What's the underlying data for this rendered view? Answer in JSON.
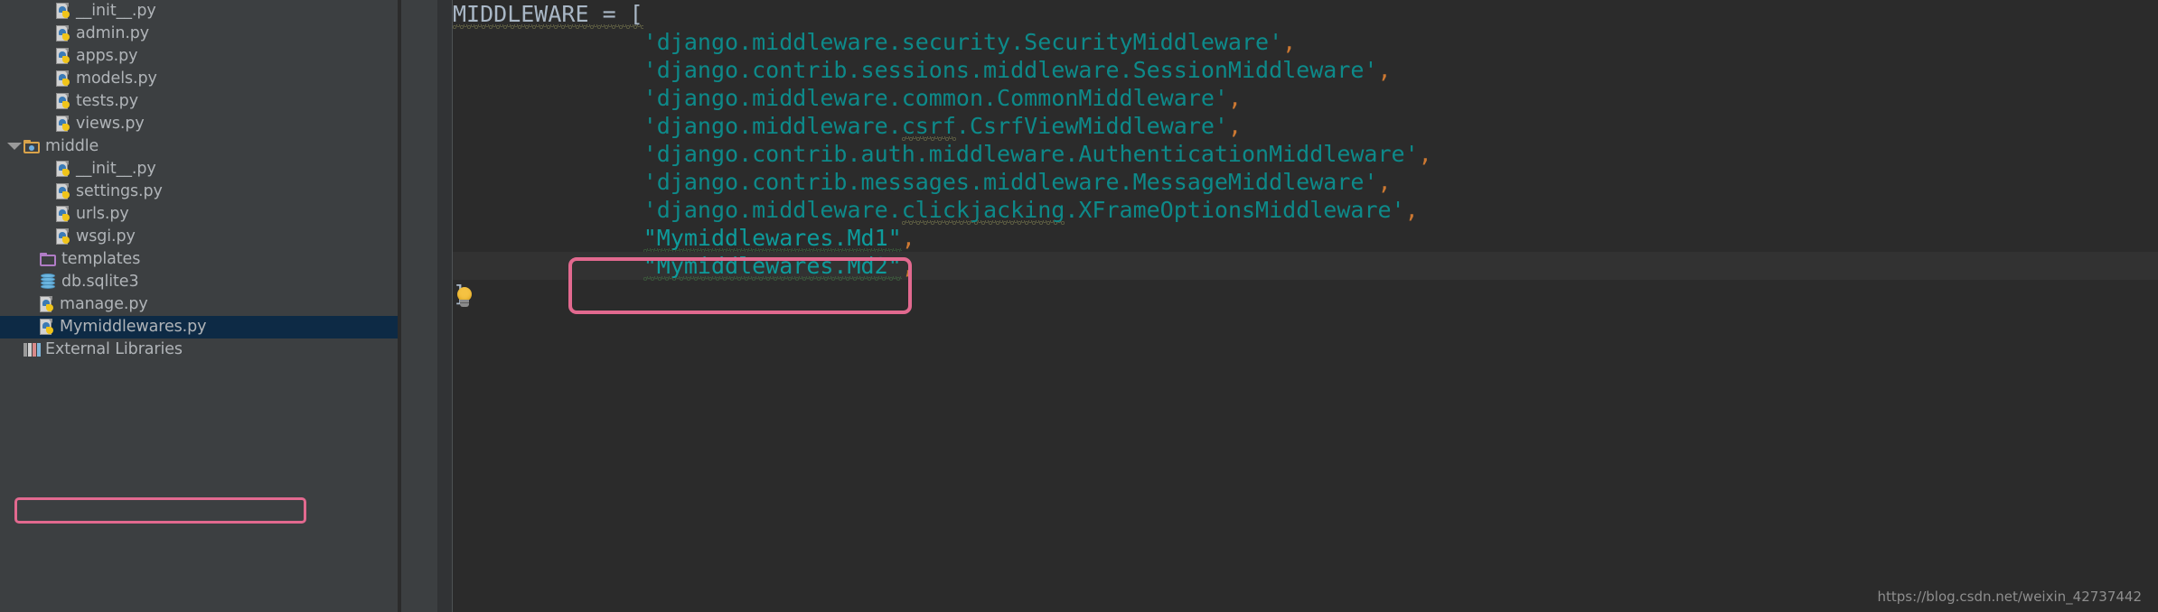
{
  "sidebar": {
    "items": [
      {
        "label": "__init__.py",
        "icon": "python-file-icon",
        "indent": 3,
        "type": "py",
        "arrow": false,
        "selected": false
      },
      {
        "label": "admin.py",
        "icon": "python-file-icon",
        "indent": 3,
        "type": "py",
        "arrow": false,
        "selected": false
      },
      {
        "label": "apps.py",
        "icon": "python-file-icon",
        "indent": 3,
        "type": "py",
        "arrow": false,
        "selected": false
      },
      {
        "label": "models.py",
        "icon": "python-file-icon",
        "indent": 3,
        "type": "py",
        "arrow": false,
        "selected": false
      },
      {
        "label": "tests.py",
        "icon": "python-file-icon",
        "indent": 3,
        "type": "py",
        "arrow": false,
        "selected": false
      },
      {
        "label": "views.py",
        "icon": "python-file-icon",
        "indent": 3,
        "type": "py",
        "arrow": false,
        "selected": false
      },
      {
        "label": "middle",
        "icon": "folder-orange-icon",
        "indent": 1,
        "type": "folder-orange",
        "arrow": true,
        "selected": false
      },
      {
        "label": "__init__.py",
        "icon": "python-file-icon",
        "indent": 3,
        "type": "py",
        "arrow": false,
        "selected": false
      },
      {
        "label": "settings.py",
        "icon": "python-file-icon",
        "indent": 3,
        "type": "py",
        "arrow": false,
        "selected": false
      },
      {
        "label": "urls.py",
        "icon": "python-file-icon",
        "indent": 3,
        "type": "py",
        "arrow": false,
        "selected": false
      },
      {
        "label": "wsgi.py",
        "icon": "python-file-icon",
        "indent": 3,
        "type": "py",
        "arrow": false,
        "selected": false
      },
      {
        "label": "templates",
        "icon": "folder-purple-icon",
        "indent": 2,
        "type": "folder-purple",
        "arrow": false,
        "selected": false
      },
      {
        "label": "db.sqlite3",
        "icon": "database-icon",
        "indent": 2,
        "type": "db",
        "arrow": false,
        "selected": false
      },
      {
        "label": "manage.py",
        "icon": "python-file-icon",
        "indent": 2,
        "type": "py",
        "arrow": false,
        "selected": false
      },
      {
        "label": "Mymiddlewares.py",
        "icon": "python-file-icon",
        "indent": 2,
        "type": "py",
        "arrow": false,
        "selected": true
      },
      {
        "label": "External Libraries",
        "icon": "libraries-icon",
        "indent": 1,
        "type": "lib",
        "arrow": false,
        "selected": false
      }
    ],
    "annotation_color": "#e2698f",
    "selection_color": "#0d2a45"
  },
  "editor": {
    "gutter_hint_icon": "lightbulb-icon",
    "annotation_color": "#e2698f",
    "lines": [
      {
        "indent": 0,
        "parts": [
          {
            "text": "MIDDLEWARE = [",
            "style": "kw",
            "squiggle": "yellow"
          }
        ]
      },
      {
        "indent": 7,
        "parts": [
          {
            "text": "'django.middleware.security.SecurityMiddleware'",
            "style": "str",
            "squiggle": "none"
          },
          {
            "text": ",",
            "style": "punct",
            "squiggle": "none"
          }
        ]
      },
      {
        "indent": 7,
        "parts": [
          {
            "text": "'django.contrib.sessions.middleware.SessionMiddleware'",
            "style": "str",
            "squiggle": "none"
          },
          {
            "text": ",",
            "style": "punct",
            "squiggle": "none"
          }
        ]
      },
      {
        "indent": 7,
        "parts": [
          {
            "text": "'django.middleware.common.CommonMiddleware'",
            "style": "str",
            "squiggle": "none"
          },
          {
            "text": ",",
            "style": "punct",
            "squiggle": "none"
          }
        ]
      },
      {
        "indent": 7,
        "parts": [
          {
            "text": "'django.middleware.",
            "style": "str",
            "squiggle": "none"
          },
          {
            "text": "csrf",
            "style": "str",
            "squiggle": "yellow"
          },
          {
            "text": ".CsrfViewMiddleware'",
            "style": "str",
            "squiggle": "none"
          },
          {
            "text": ",",
            "style": "punct",
            "squiggle": "none"
          }
        ]
      },
      {
        "indent": 7,
        "parts": [
          {
            "text": "'django.contrib.auth.middleware.AuthenticationMiddleware'",
            "style": "str",
            "squiggle": "none"
          },
          {
            "text": ",",
            "style": "punct",
            "squiggle": "none"
          }
        ]
      },
      {
        "indent": 7,
        "parts": [
          {
            "text": "'django.contrib.messages.middleware.MessageMiddleware'",
            "style": "str",
            "squiggle": "none"
          },
          {
            "text": ",",
            "style": "punct",
            "squiggle": "none"
          }
        ]
      },
      {
        "indent": 7,
        "parts": [
          {
            "text": "'django.middleware.",
            "style": "str",
            "squiggle": "none"
          },
          {
            "text": "clickjacking",
            "style": "str",
            "squiggle": "yellow"
          },
          {
            "text": ".XFrameOptionsMiddleware'",
            "style": "str",
            "squiggle": "none"
          },
          {
            "text": ",",
            "style": "punct",
            "squiggle": "none"
          }
        ]
      },
      {
        "indent": 7,
        "highlight": true,
        "parts": [
          {
            "text": "\"Mymiddlewares.Md1\"",
            "style": "str2",
            "squiggle": "green"
          },
          {
            "text": ",",
            "style": "punct",
            "squiggle": "none"
          }
        ]
      },
      {
        "indent": 7,
        "highlight": true,
        "current": true,
        "parts": [
          {
            "text": "\"Mymiddlewares.Md2\"",
            "style": "str2",
            "squiggle": "green"
          },
          {
            "text": ",",
            "style": "punct",
            "squiggle": "none"
          }
        ]
      },
      {
        "indent": 0,
        "parts": [
          {
            "text": "]",
            "style": "brk",
            "squiggle": "none"
          }
        ]
      }
    ]
  },
  "watermark": {
    "text": "https://blog.csdn.net/weixin_42737442"
  }
}
